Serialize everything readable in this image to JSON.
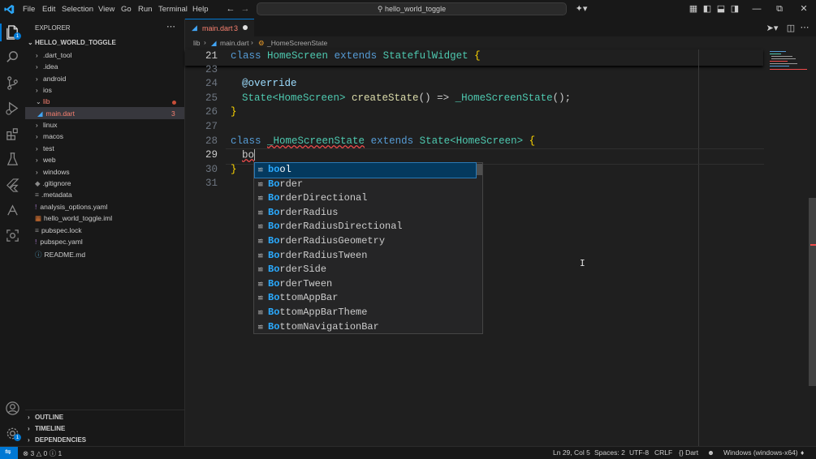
{
  "menu": [
    "File",
    "Edit",
    "Selection",
    "View",
    "Go",
    "Run",
    "Terminal",
    "Help"
  ],
  "command_center": "hello_world_toggle",
  "window_controls": [
    "minimize-icon",
    "restore-icon",
    "close-icon"
  ],
  "activity_badges": {
    "explorer": "1",
    "manage": "1"
  },
  "sidebar": {
    "title": "EXPLORER",
    "root": "HELLO_WORLD_TOGGLE",
    "items": [
      {
        "label": ".dart_tool",
        "kind": "folder"
      },
      {
        "label": ".idea",
        "kind": "folder"
      },
      {
        "label": "android",
        "kind": "folder"
      },
      {
        "label": "ios",
        "kind": "folder"
      },
      {
        "label": "lib",
        "kind": "folder-open"
      },
      {
        "label": "main.dart",
        "kind": "file",
        "badge": "3"
      },
      {
        "label": "linux",
        "kind": "folder"
      },
      {
        "label": "macos",
        "kind": "folder"
      },
      {
        "label": "test",
        "kind": "folder"
      },
      {
        "label": "web",
        "kind": "folder"
      },
      {
        "label": "windows",
        "kind": "folder"
      },
      {
        "label": ".gitignore",
        "kind": "file"
      },
      {
        "label": ".metadata",
        "kind": "file"
      },
      {
        "label": "analysis_options.yaml",
        "kind": "file"
      },
      {
        "label": "hello_world_toggle.iml",
        "kind": "file"
      },
      {
        "label": "pubspec.lock",
        "kind": "file"
      },
      {
        "label": "pubspec.yaml",
        "kind": "file"
      },
      {
        "label": "README.md",
        "kind": "file"
      }
    ],
    "sections": [
      "OUTLINE",
      "TIMELINE",
      "DEPENDENCIES"
    ]
  },
  "tab": {
    "name": "main.dart",
    "badge": "3"
  },
  "breadcrumb": [
    "lib",
    "main.dart",
    "_HomeScreenState"
  ],
  "editor": {
    "line_numbers": [
      "21",
      "23",
      "24",
      "25",
      "26",
      "27",
      "28",
      "29",
      "30",
      "31"
    ],
    "lines": {
      "l21": [
        "class",
        "HomeScreen",
        "extends",
        "StatefulWidget",
        "{"
      ],
      "l24": "@override",
      "l25": [
        "State<HomeScreen>",
        "createState",
        "()",
        "=>",
        "_HomeScreenState",
        "();"
      ],
      "l26": "}",
      "l28": [
        "class",
        "_HomeScreenState",
        "extends",
        "State<HomeScreen>",
        "{"
      ],
      "l29": "bo",
      "l30": "}"
    }
  },
  "suggestions": [
    {
      "match": "bo",
      "rest": "ol"
    },
    {
      "match": "Bo",
      "rest": "rder"
    },
    {
      "match": "Bo",
      "rest": "rderDirectional"
    },
    {
      "match": "Bo",
      "rest": "rderRadius"
    },
    {
      "match": "Bo",
      "rest": "rderRadiusDirectional"
    },
    {
      "match": "Bo",
      "rest": "rderRadiusGeometry"
    },
    {
      "match": "Bo",
      "rest": "rderRadiusTween"
    },
    {
      "match": "Bo",
      "rest": "rderSide"
    },
    {
      "match": "Bo",
      "rest": "rderTween"
    },
    {
      "match": "Bo",
      "rest": "ttomAppBar"
    },
    {
      "match": "Bo",
      "rest": "ttomAppBarTheme"
    },
    {
      "match": "Bo",
      "rest": "ttomNavigationBar"
    }
  ],
  "status": {
    "errors": "3",
    "warnings": "0",
    "info": "1",
    "position": "Ln 29, Col 5",
    "spaces": "Spaces: 2",
    "encoding": "UTF-8",
    "eol": "CRLF",
    "language": "Dart",
    "platform": "Windows (windows-x64)"
  },
  "colors": {
    "accent": "#0078d4",
    "error": "#f14c4c",
    "match": "#2aaaff",
    "selected": "#04395e"
  }
}
